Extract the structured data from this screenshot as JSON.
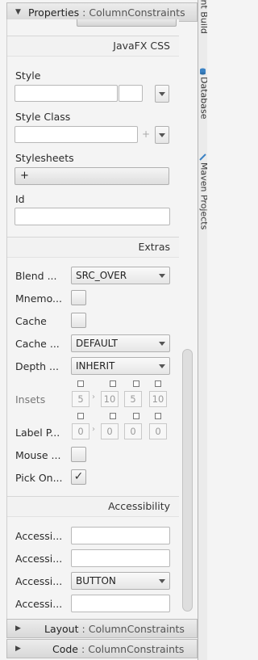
{
  "panes": {
    "properties": {
      "title": "Properties",
      "separator": ":",
      "subject": "ColumnConstraints",
      "expanded": true
    },
    "layout": {
      "title": "Layout",
      "separator": ":",
      "subject": "ColumnConstraints",
      "expanded": false
    },
    "code": {
      "title": "Code",
      "separator": ":",
      "subject": "ColumnConstraints",
      "expanded": false
    }
  },
  "sections": {
    "javafx_css": {
      "header": "JavaFX CSS",
      "style_label": "Style",
      "style_value": "",
      "style_class_label": "Style Class",
      "style_class_value": "",
      "stylesheets_label": "Stylesheets",
      "stylesheets_add": "+",
      "id_label": "Id",
      "id_value": ""
    },
    "extras": {
      "header": "Extras",
      "blend_label": "Blend ...",
      "blend_value": "SRC_OVER",
      "mnemonic_label": "Mnemo...",
      "mnemonic_checked": false,
      "cache_label": "Cache",
      "cache_checked": false,
      "cache_hint_label": "Cache ...",
      "cache_hint_value": "DEFAULT",
      "depth_label": "Depth ...",
      "depth_value": "INHERIT",
      "insets_label": "Insets",
      "insets_values": [
        "5",
        "10",
        "5",
        "10"
      ],
      "label_padding_label": "Label P...",
      "label_padding_values": [
        "0",
        "0",
        "0",
        "0"
      ],
      "mouse_label": "Mouse ...",
      "mouse_checked": false,
      "pick_label": "Pick On...",
      "pick_checked": true,
      "check_mark": "✓",
      "link_glyph": "›"
    },
    "accessibility": {
      "header": "Accessibility",
      "row1_label": "Accessi...",
      "row1_value": "",
      "row2_label": "Accessi...",
      "row2_value": "",
      "row3_label": "Accessi...",
      "row3_value": "BUTTON",
      "row4_label": "Accessi...",
      "row4_value": ""
    }
  },
  "side_strip": [
    {
      "label": "Ant Build",
      "icon": "ant-icon"
    },
    {
      "label": "Database",
      "icon": "database-icon",
      "color": "#3b82c4"
    },
    {
      "label": "Maven Projects",
      "icon": "maven-icon",
      "color": "#3b82c4"
    }
  ],
  "colors": {
    "accent_blue": "#3b82c4",
    "panel_bg": "#f4f4f4"
  }
}
